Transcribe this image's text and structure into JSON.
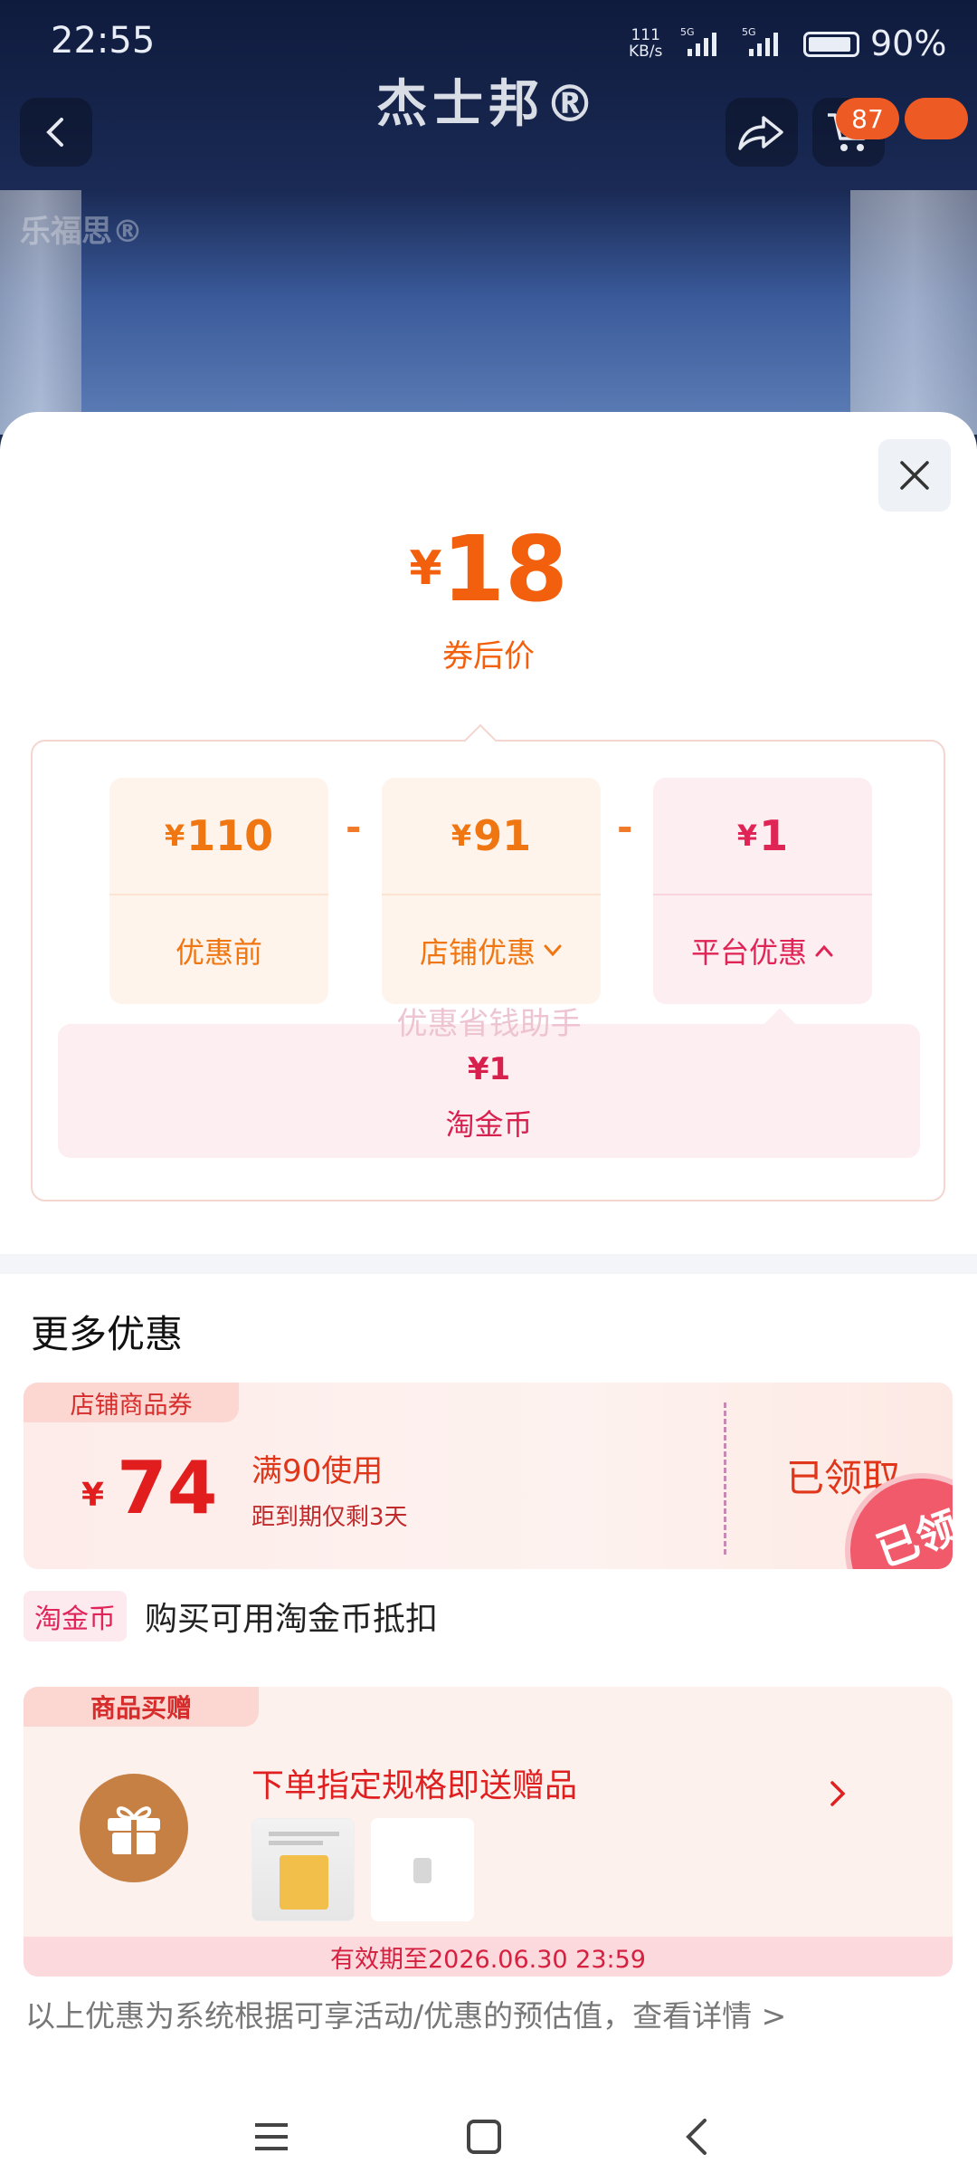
{
  "status_bar": {
    "time": "22:55",
    "net_speed_value": "111",
    "net_speed_unit": "KB/s",
    "sim1": "5G",
    "sim2": "5G",
    "battery": "90%"
  },
  "header": {
    "title": "杰士邦®",
    "cart_badge": "87",
    "banner_brand": "乐福思®"
  },
  "sheet": {
    "final_price_symbol": "¥",
    "final_price": "18",
    "final_price_label": "券后价",
    "breakdown": [
      {
        "symbol": "¥",
        "amount": "110",
        "label": "优惠前"
      },
      {
        "symbol": "¥",
        "amount": "91",
        "label": "店铺优惠"
      },
      {
        "symbol": "¥",
        "amount": "1",
        "label": "平台优惠"
      }
    ],
    "minus_sign": "-",
    "watermark": "优惠省钱助手",
    "platform_detail": {
      "amount": "¥1",
      "label": "淘金币"
    }
  },
  "more": {
    "title": "更多优惠",
    "coupon": {
      "tag": "店铺商品券",
      "symbol": "¥",
      "amount": "74",
      "condition": "满90使用",
      "expiry": "距到期仅剩3天",
      "status": "已领取",
      "stamp": "已领"
    },
    "taojinbi": {
      "tag": "淘金币",
      "text": "购买可用淘金币抵扣"
    },
    "gift": {
      "tag": "商品买赠",
      "title": "下单指定规格即送赠品",
      "validity": "有效期至2026.06.30 23:59"
    },
    "disclaimer": "以上优惠为系统根据可享活动/优惠的预估值，查看详情 >"
  },
  "colors": {
    "accent_orange": "#f25f0d",
    "accent_pink": "#e02456",
    "coupon_red": "#e11d1d"
  },
  "icons": [
    "back-icon",
    "share-icon",
    "cart-icon",
    "message-icon",
    "close-icon",
    "chevron-down-icon",
    "chevron-up-icon",
    "gift-icon",
    "chevron-right-icon",
    "menu-icon",
    "home-icon",
    "nav-back-icon"
  ]
}
